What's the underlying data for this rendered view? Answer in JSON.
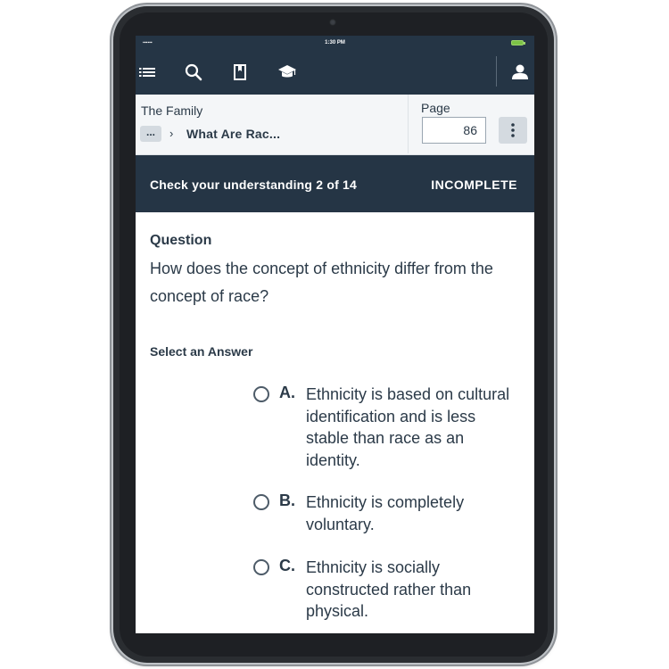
{
  "status_bar": {
    "signal": "▪▪▪▪▪▪",
    "time": "1:30 PM"
  },
  "toolbar": {
    "icons": [
      "list-icon",
      "search-icon",
      "bookmark-icon",
      "graduation-cap-icon",
      "user-icon"
    ]
  },
  "breadcrumb": {
    "book_title": "The Family",
    "ellipsis": "...",
    "separator": "›",
    "current": "What Are Rac..."
  },
  "page_nav": {
    "label": "Page",
    "value": "86"
  },
  "banner": {
    "title": "Check your understanding 2 of 14",
    "status": "INCOMPLETE"
  },
  "question": {
    "heading": "Question",
    "text": "How does the concept of ethnicity differ from the concept of race?",
    "select_label": "Select an Answer",
    "options": [
      {
        "letter": "A.",
        "text": "Ethnicity is based on cultural identification and is less stable than race as an identity."
      },
      {
        "letter": "B.",
        "text": "Ethnicity is completely voluntary."
      },
      {
        "letter": "C.",
        "text": "Ethnicity is socially constructed rather than physical."
      }
    ]
  },
  "colors": {
    "header_navy": "#253545",
    "text_dark": "#2b3a48"
  }
}
